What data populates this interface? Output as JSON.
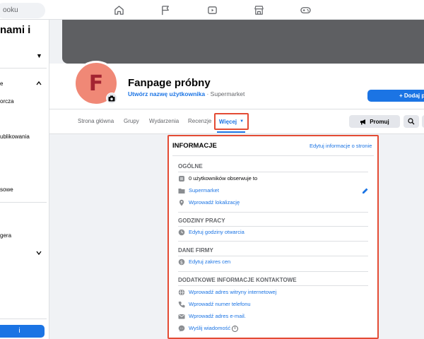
{
  "topbar": {
    "search_text": "ooku"
  },
  "sidebar": {
    "title": "nami i",
    "items": [
      {
        "label": "e"
      },
      {
        "label": "orcza"
      },
      {
        "label": "ublikowania"
      },
      {
        "label": "sowe"
      },
      {
        "label": "gera"
      }
    ]
  },
  "page": {
    "avatar_letter": "F",
    "name": "Fanpage próbny",
    "username_link": "Utwórz nazwę użytkownika",
    "separator": " · ",
    "category": "Supermarket",
    "add_button": "+ Dodaj p"
  },
  "tabs": {
    "items": [
      {
        "label": "Strona główna"
      },
      {
        "label": "Grupy"
      },
      {
        "label": "Wydarzenia"
      },
      {
        "label": "Recenzje"
      }
    ],
    "more_label": "Więcej",
    "promote_label": "Promuj"
  },
  "info": {
    "title": "INFORMACJE",
    "edit_link": "Edytuj informacje o stronie",
    "general": {
      "heading": "OGÓLNE",
      "followers": "0 użytkowników obserwuje to",
      "category": "Supermarket",
      "location": "Wprowadź lokalizację"
    },
    "hours": {
      "heading": "GODZINY PRACY",
      "edit": "Edytuj godziny otwarcia"
    },
    "business": {
      "heading": "DANE FIRMY",
      "price": "Edytuj zakres cen"
    },
    "contact": {
      "heading": "DODATKOWE INFORMACJE KONTAKTOWE",
      "website": "Wprowadź adres witryny internetowej",
      "phone": "Wprowadź numer telefonu",
      "email": "Wprowadź adres e-mail.",
      "message": "Wyślij wiadomość"
    }
  },
  "colors": {
    "accent": "#1b74e4",
    "highlight_border": "#e34b34",
    "avatar_bg": "#f08876",
    "avatar_letter": "#a32431"
  }
}
